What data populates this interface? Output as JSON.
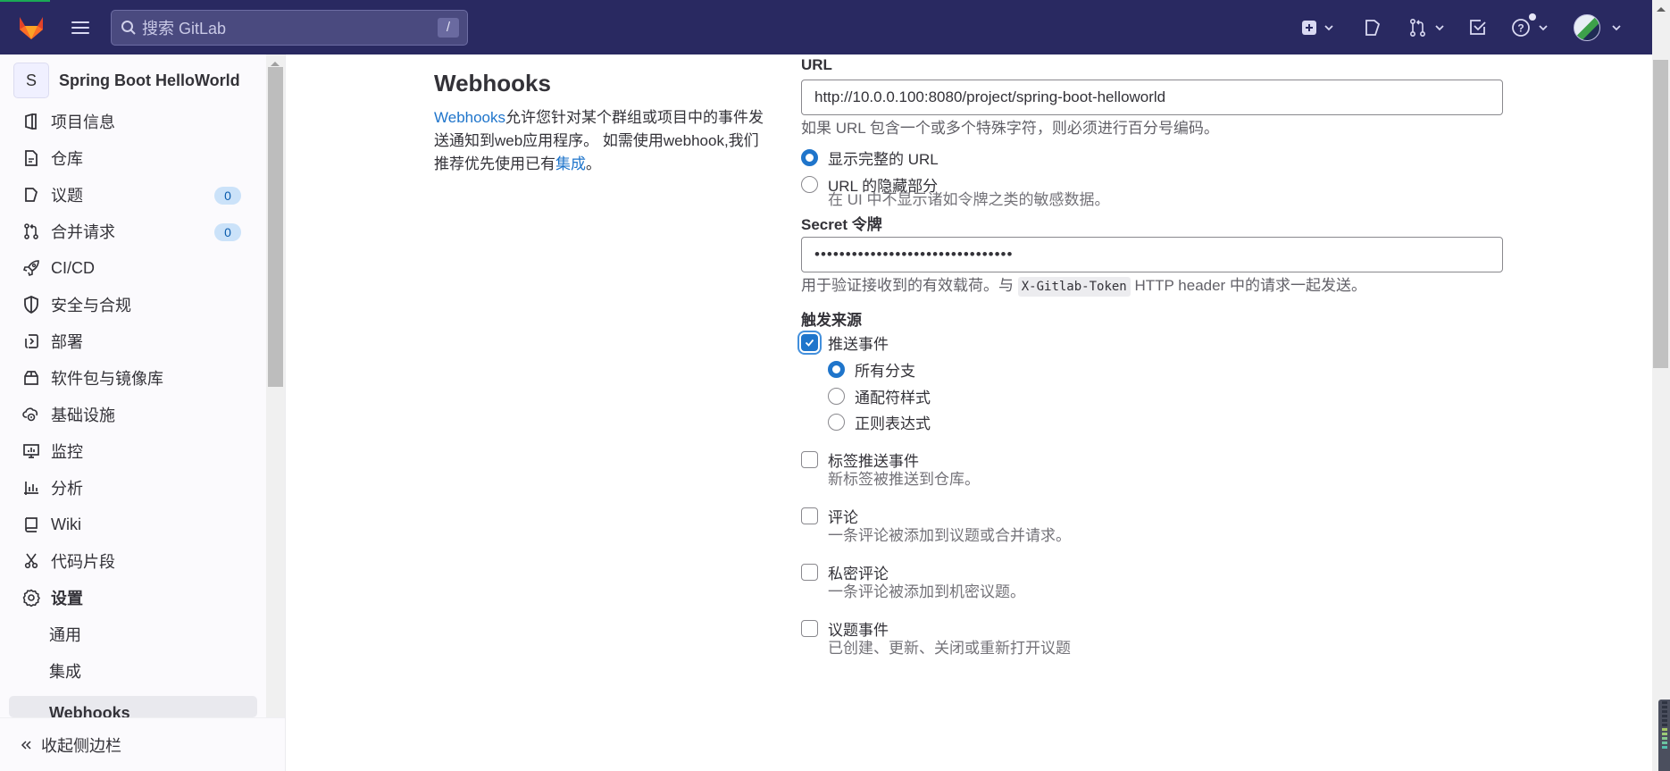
{
  "topbar": {
    "search_placeholder": "搜索 GitLab",
    "search_shortcut": "/",
    "icons": [
      "gitlab-logo-icon",
      "hamburger-menu-icon",
      "create-new-icon",
      "issues-icon",
      "merge-requests-icon",
      "todo-icon",
      "help-icon",
      "user-avatar"
    ]
  },
  "sidebar": {
    "project_initial": "S",
    "project_name": "Spring Boot HelloWorld",
    "items": [
      {
        "label": "项目信息",
        "icon": "project-info-icon"
      },
      {
        "label": "仓库",
        "icon": "repository-icon"
      },
      {
        "label": "议题",
        "icon": "issues-icon",
        "badge": "0"
      },
      {
        "label": "合并请求",
        "icon": "merge-request-icon",
        "badge": "0"
      },
      {
        "label": "CI/CD",
        "icon": "rocket-icon"
      },
      {
        "label": "安全与合规",
        "icon": "shield-icon"
      },
      {
        "label": "部署",
        "icon": "deployments-icon"
      },
      {
        "label": "软件包与镜像库",
        "icon": "package-icon"
      },
      {
        "label": "基础设施",
        "icon": "cloud-gear-icon"
      },
      {
        "label": "监控",
        "icon": "monitor-icon"
      },
      {
        "label": "分析",
        "icon": "chart-icon"
      },
      {
        "label": "Wiki",
        "icon": "book-icon"
      },
      {
        "label": "代码片段",
        "icon": "scissors-icon"
      },
      {
        "label": "设置",
        "icon": "gear-icon"
      }
    ],
    "sub_items": [
      {
        "label": "通用"
      },
      {
        "label": "集成"
      },
      {
        "label": "Webhooks",
        "active": true
      }
    ],
    "collapse_label": "收起侧边栏"
  },
  "main": {
    "title": "Webhooks",
    "intro_link": "Webhooks",
    "intro_text": "允许您针对某个群组或项目中的事件发送通知到web应用程序。 如需使用webhook,我们推荐优先使用已有",
    "intro_link2": "集成",
    "intro_end": "。",
    "url_label": "URL",
    "url_value": "http://10.0.0.100:8080/project/spring-boot-helloworld",
    "url_help": "如果 URL 包含一个或多个特殊字符，则必须进行百分号编码。",
    "url_mask_options": [
      {
        "label": "显示完整的 URL",
        "selected": true
      },
      {
        "label": "URL 的隐藏部分",
        "selected": false,
        "description": "在 UI 中不显示诸如令牌之类的敏感数据。"
      }
    ],
    "secret_label": "Secret 令牌",
    "secret_value": "••••••••••••••••••••••••••••••••",
    "secret_help_pre": "用于验证接收到的有效载荷。与",
    "secret_help_code": "X-Gitlab-Token",
    "secret_help_post": "HTTP header 中的请求一起发送。",
    "trigger_label": "触发来源",
    "push_events": {
      "label": "推送事件",
      "checked": true
    },
    "branch_options": [
      {
        "label": "所有分支",
        "selected": true
      },
      {
        "label": "通配符样式",
        "selected": false
      },
      {
        "label": "正则表达式",
        "selected": false
      }
    ],
    "triggers": [
      {
        "label": "标签推送事件",
        "checked": false,
        "description": "新标签被推送到仓库。"
      },
      {
        "label": "评论",
        "checked": false,
        "description": "一条评论被添加到议题或合并请求。"
      },
      {
        "label": "私密评论",
        "checked": false,
        "description": "一条评论被添加到机密议题。"
      },
      {
        "label": "议题事件",
        "checked": false,
        "description": "已创建、更新、关闭或重新打开议题"
      }
    ]
  },
  "colors": {
    "topbar_bg": "#292961",
    "accent": "#1f75cb",
    "badge_bg": "#cbe2f9",
    "badge_text": "#0b5cad"
  }
}
